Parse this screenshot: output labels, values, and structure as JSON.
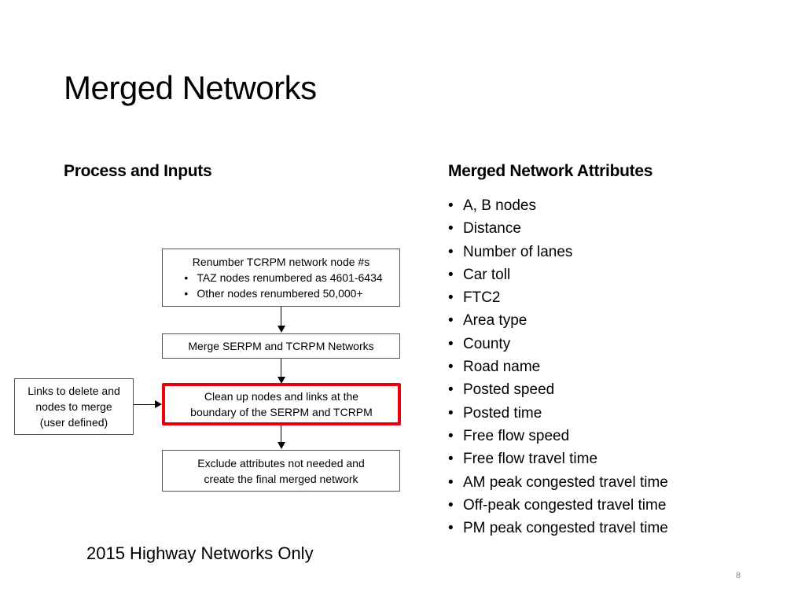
{
  "slide": {
    "title": "Merged Networks",
    "page_number": "8",
    "note": "2015 Highway Networks Only"
  },
  "left": {
    "heading": "Process and Inputs",
    "flow": {
      "step1": {
        "title": "Renumber TCRPM network node #s",
        "bullets": [
          "TAZ nodes renumbered as 4601-6434",
          "Other nodes renumbered 50,000+"
        ]
      },
      "step2": {
        "line1": "Merge SERPM and TCRPM Networks"
      },
      "step3": {
        "line1": "Clean up nodes and links at the",
        "line2": "boundary of the SERPM and TCRPM",
        "highlight_color": "#e8000b"
      },
      "step4": {
        "line1": "Exclude attributes not needed and",
        "line2": "create the final merged network"
      },
      "input": {
        "line1": "Links to delete and",
        "line2": "nodes to merge",
        "line3": "(user defined)"
      }
    }
  },
  "right": {
    "heading": "Merged Network Attributes",
    "attributes": [
      "A, B nodes",
      "Distance",
      "Number of lanes",
      "Car toll",
      "FTC2",
      "Area type",
      "County",
      "Road name",
      "Posted speed",
      "Posted time",
      "Free flow speed",
      "Free flow travel time",
      "AM peak congested travel time",
      "Off-peak congested travel time",
      "PM peak congested travel time"
    ]
  }
}
